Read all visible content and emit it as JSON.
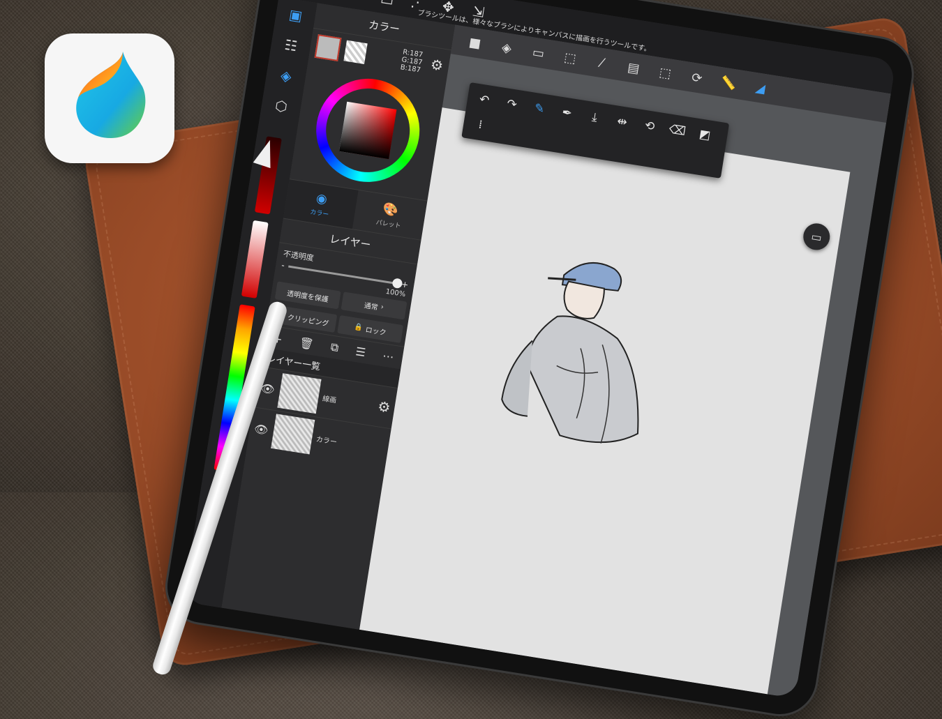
{
  "colors": {
    "accent": "#3d9df2",
    "selected_color": "#bbbbbb"
  },
  "toolbar": {
    "tools": [
      {
        "name": "menu",
        "icon": "menu-icon",
        "glyph": "☰"
      },
      {
        "name": "brush",
        "icon": "brush-icon",
        "glyph": "✎"
      },
      {
        "name": "eraser",
        "icon": "eraser-icon",
        "glyph": "▱"
      },
      {
        "name": "select-rect",
        "icon": "rectangle-icon",
        "glyph": "□"
      },
      {
        "name": "vector",
        "icon": "vector-icon",
        "glyph": "⋰"
      },
      {
        "name": "move",
        "icon": "move-icon",
        "glyph": "✥"
      },
      {
        "name": "transform",
        "icon": "transform-icon",
        "glyph": "⇲"
      }
    ],
    "hint": "ブラシツールは、様々なブラシによりキャンバスに描画を行うツールです。"
  },
  "subtoolbar": {
    "tools": [
      {
        "icon": "fill-color-icon",
        "glyph": "■"
      },
      {
        "icon": "bucket-icon",
        "glyph": "◈"
      },
      {
        "icon": "gradient-icon",
        "glyph": "▭"
      },
      {
        "icon": "selection-icon",
        "glyph": "⬚"
      },
      {
        "icon": "magic-wand-icon",
        "glyph": "⁄"
      },
      {
        "icon": "layers-copy-icon",
        "glyph": "▤"
      },
      {
        "icon": "select-layer-icon",
        "glyph": "⬚"
      },
      {
        "icon": "rotate-icon",
        "glyph": "⟳"
      },
      {
        "icon": "ruler-icon",
        "glyph": "📏"
      },
      {
        "icon": "snap-icon",
        "glyph": "◢"
      }
    ]
  },
  "color_panel": {
    "title": "カラー",
    "rgb": {
      "r": "R:187",
      "g": "G:187",
      "b": "B:187"
    },
    "tabs": [
      {
        "label": "カラー",
        "icon": "color-circle-icon",
        "glyph": "◉"
      },
      {
        "label": "パレット",
        "icon": "palette-icon",
        "glyph": "🎨"
      }
    ]
  },
  "layer_panel": {
    "title": "レイヤー",
    "opacity_label": "不透明度",
    "opacity_minus": "-",
    "opacity_plus": "+",
    "opacity_value": "100%",
    "protect_alpha": "透明度を保護",
    "blend_mode": "通常",
    "clipping": "クリッピング",
    "lock": "ロック",
    "list_title": "レイヤー一覧",
    "layers": [
      {
        "name": "線画",
        "visible": true
      },
      {
        "name": "カラー",
        "visible": true
      }
    ]
  },
  "canvas_tools": {
    "row1": [
      {
        "icon": "undo-icon",
        "glyph": "↶"
      },
      {
        "icon": "redo-icon",
        "glyph": "↷"
      },
      {
        "icon": "brush-hand-icon",
        "glyph": "✎"
      },
      {
        "icon": "eyedropper-icon",
        "glyph": "✒"
      },
      {
        "icon": "save-icon",
        "glyph": "⤓"
      }
    ],
    "row2": [
      {
        "icon": "flip-icon",
        "glyph": "⇹"
      },
      {
        "icon": "rotate-reset-icon",
        "glyph": "⟲"
      },
      {
        "icon": "erase-icon",
        "glyph": "⌫"
      },
      {
        "icon": "fullscreen-icon",
        "glyph": "◩"
      },
      {
        "icon": "grid-icon",
        "glyph": "⁞"
      }
    ]
  }
}
